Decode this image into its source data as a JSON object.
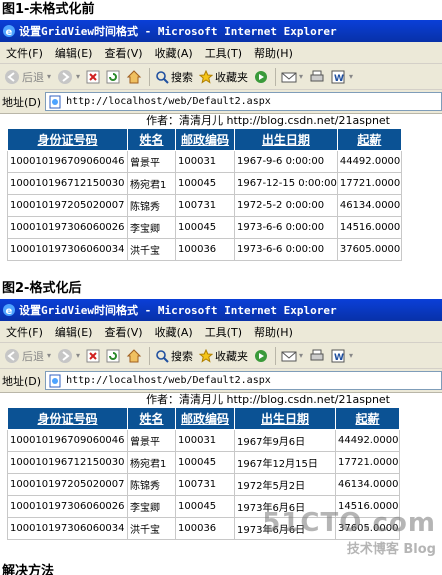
{
  "headings": {
    "fig1": "图1-未格式化前",
    "fig2": "图2-格式化后",
    "footer": "解决方法"
  },
  "window": {
    "title": "设置GridView时间格式 - Microsoft Internet Explorer"
  },
  "menu": [
    "文件(F)",
    "编辑(E)",
    "查看(V)",
    "收藏(A)",
    "工具(T)",
    "帮助(H)"
  ],
  "toolbar": {
    "back": "后退",
    "search": "搜索",
    "favorites": "收藏夹"
  },
  "address": {
    "label": "地址(D)",
    "url": "http://localhost/web/Default2.aspx"
  },
  "author": "作者：清清月儿 http://blog.csdn.net/21aspnet",
  "columns": [
    "身份证号码",
    "姓名",
    "邮政编码",
    "出生日期",
    "起薪"
  ],
  "table1": [
    [
      "100010196709060046",
      "曾景平",
      "100031",
      "1967-9-6 0:00:00",
      "44492.0000"
    ],
    [
      "100010196712150030",
      "杨宛君1",
      "100045",
      "1967-12-15 0:00:00",
      "17721.0000"
    ],
    [
      "100010197205020007",
      "陈锦秀",
      "100731",
      "1972-5-2 0:00:00",
      "46134.0000"
    ],
    [
      "100010197306060026",
      "李宝卿",
      "100045",
      "1973-6-6 0:00:00",
      "14516.0000"
    ],
    [
      "100010197306060034",
      "洪千宝",
      "100036",
      "1973-6-6 0:00:00",
      "37605.0000"
    ]
  ],
  "table2": [
    [
      "100010196709060046",
      "曾景平",
      "100031",
      "1967年9月6日",
      "44492.0000"
    ],
    [
      "100010196712150030",
      "杨宛君1",
      "100045",
      "1967年12月15日",
      "17721.0000"
    ],
    [
      "100010197205020007",
      "陈锦秀",
      "100731",
      "1972年5月2日",
      "46134.0000"
    ],
    [
      "100010197306060026",
      "李宝卿",
      "100045",
      "1973年6月6日",
      "14516.0000"
    ],
    [
      "100010197306060034",
      "洪千宝",
      "100036",
      "1973年6月6日",
      "37605.0000"
    ]
  ],
  "watermark": {
    "line1": "51CTO.com",
    "line2": "技术博客 Blog"
  },
  "colors": {
    "header_bg": "#0b5294",
    "titlebar": "#0a3fd8",
    "chrome": "#ece9d8"
  }
}
